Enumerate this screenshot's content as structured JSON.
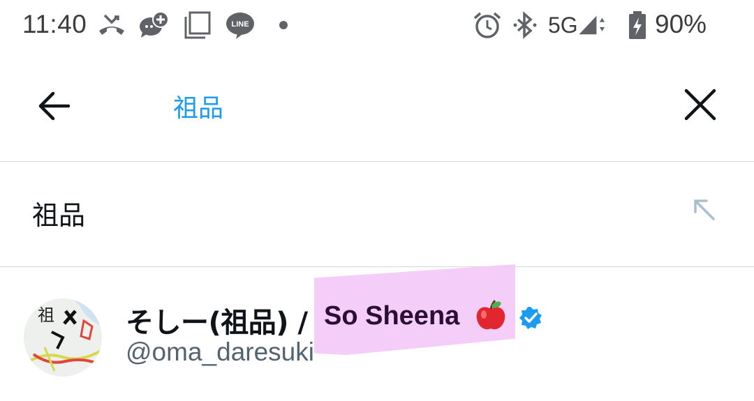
{
  "status_bar": {
    "time": "11:40",
    "network": "5G",
    "battery": "90%",
    "icons": [
      "missed-call-icon",
      "chat-plus-icon",
      "copy-icon",
      "line-app-icon",
      "notification-dot",
      "alarm-icon",
      "bluetooth-icon",
      "signal-icon",
      "battery-charging-icon"
    ]
  },
  "search": {
    "query": "祖品",
    "back_icon": "arrow-left-icon",
    "clear_icon": "close-icon"
  },
  "suggestions": [
    {
      "text": "祖品",
      "icon": "arrow-up-left-icon"
    }
  ],
  "users": [
    {
      "display_name": "そしー(祖品) / ",
      "display_name_en": "So Sheena",
      "emoji": "apple-emoji",
      "verified": true,
      "handle": "@oma_daresuki",
      "avatar_text": "祖"
    }
  ],
  "colors": {
    "accent": "#1d9bf0",
    "highlight": "#f3c8f7",
    "divider": "#cfd9de",
    "secondary_text": "#536471"
  }
}
